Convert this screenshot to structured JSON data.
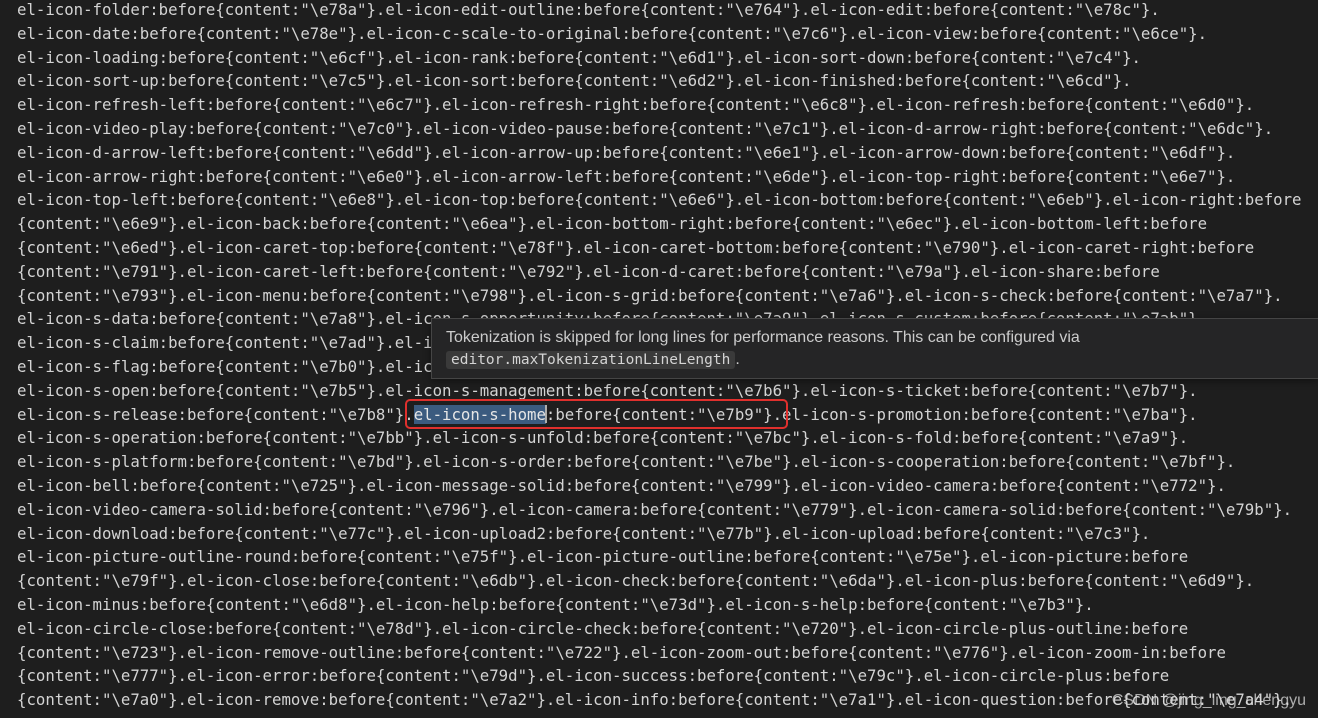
{
  "lines": [
    "el-icon-folder:before{content:\"\\e78a\"}.el-icon-edit-outline:before{content:\"\\e764\"}.el-icon-edit:before{content:\"\\e78c\"}.",
    "el-icon-date:before{content:\"\\e78e\"}.el-icon-c-scale-to-original:before{content:\"\\e7c6\"}.el-icon-view:before{content:\"\\e6ce\"}.",
    "el-icon-loading:before{content:\"\\e6cf\"}.el-icon-rank:before{content:\"\\e6d1\"}.el-icon-sort-down:before{content:\"\\e7c4\"}.",
    "el-icon-sort-up:before{content:\"\\e7c5\"}.el-icon-sort:before{content:\"\\e6d2\"}.el-icon-finished:before{content:\"\\e6cd\"}.",
    "el-icon-refresh-left:before{content:\"\\e6c7\"}.el-icon-refresh-right:before{content:\"\\e6c8\"}.el-icon-refresh:before{content:\"\\e6d0\"}.",
    "el-icon-video-play:before{content:\"\\e7c0\"}.el-icon-video-pause:before{content:\"\\e7c1\"}.el-icon-d-arrow-right:before{content:\"\\e6dc\"}.",
    "el-icon-d-arrow-left:before{content:\"\\e6dd\"}.el-icon-arrow-up:before{content:\"\\e6e1\"}.el-icon-arrow-down:before{content:\"\\e6df\"}.",
    "el-icon-arrow-right:before{content:\"\\e6e0\"}.el-icon-arrow-left:before{content:\"\\e6de\"}.el-icon-top-right:before{content:\"\\e6e7\"}.",
    "el-icon-top-left:before{content:\"\\e6e8\"}.el-icon-top:before{content:\"\\e6e6\"}.el-icon-bottom:before{content:\"\\e6eb\"}.el-icon-right:before",
    "{content:\"\\e6e9\"}.el-icon-back:before{content:\"\\e6ea\"}.el-icon-bottom-right:before{content:\"\\e6ec\"}.el-icon-bottom-left:before",
    "{content:\"\\e6ed\"}.el-icon-caret-top:before{content:\"\\e78f\"}.el-icon-caret-bottom:before{content:\"\\e790\"}.el-icon-caret-right:before",
    "{content:\"\\e791\"}.el-icon-caret-left:before{content:\"\\e792\"}.el-icon-d-caret:before{content:\"\\e79a\"}.el-icon-share:before",
    "{content:\"\\e793\"}.el-icon-menu:before{content:\"\\e798\"}.el-icon-s-grid:before{content:\"\\e7a6\"}.el-icon-s-check:before{content:\"\\e7a7\"}.",
    "el-icon-s-data:before{content:\"\\e7a8\"}.el-icon-s-opportunity:before{content:\"\\e7a9\"}.el-icon-s-custom:before{content:\"\\e7ab\"}.",
    "el-icon-s-claim:before{content:\"\\e7ad\"}.el-icon-s-finance:before{content:\"\\e7ae\"}.el-icon-s-comment:before{content:\"\\e7af\"}.",
    "el-icon-s-flag:before{content:\"\\e7b0\"}.el-icon-s-marketing:before{content:\"\\e7b1\"}.el-icon-s-shop:before{content:\"\\e7b2\"}.",
    "el-icon-s-open:before{content:\"\\e7b5\"}.el-icon-s-management:before{content:\"\\e7b6\"}.el-icon-s-ticket:before{content:\"\\e7b7\"}.",
    null,
    "el-icon-s-operation:before{content:\"\\e7bb\"}.el-icon-s-unfold:before{content:\"\\e7bc\"}.el-icon-s-fold:before{content:\"\\e7a9\"}.",
    "el-icon-s-platform:before{content:\"\\e7bd\"}.el-icon-s-order:before{content:\"\\e7be\"}.el-icon-s-cooperation:before{content:\"\\e7bf\"}.",
    "el-icon-bell:before{content:\"\\e725\"}.el-icon-message-solid:before{content:\"\\e799\"}.el-icon-video-camera:before{content:\"\\e772\"}.",
    "el-icon-video-camera-solid:before{content:\"\\e796\"}.el-icon-camera:before{content:\"\\e779\"}.el-icon-camera-solid:before{content:\"\\e79b\"}.",
    "el-icon-download:before{content:\"\\e77c\"}.el-icon-upload2:before{content:\"\\e77b\"}.el-icon-upload:before{content:\"\\e7c3\"}.",
    "el-icon-picture-outline-round:before{content:\"\\e75f\"}.el-icon-picture-outline:before{content:\"\\e75e\"}.el-icon-picture:before",
    "{content:\"\\e79f\"}.el-icon-close:before{content:\"\\e6db\"}.el-icon-check:before{content:\"\\e6da\"}.el-icon-plus:before{content:\"\\e6d9\"}.",
    "el-icon-minus:before{content:\"\\e6d8\"}.el-icon-help:before{content:\"\\e73d\"}.el-icon-s-help:before{content:\"\\e7b3\"}.",
    "el-icon-circle-close:before{content:\"\\e78d\"}.el-icon-circle-check:before{content:\"\\e720\"}.el-icon-circle-plus-outline:before",
    "{content:\"\\e723\"}.el-icon-remove-outline:before{content:\"\\e722\"}.el-icon-zoom-out:before{content:\"\\e776\"}.el-icon-zoom-in:before",
    "{content:\"\\e777\"}.el-icon-error:before{content:\"\\e79d\"}.el-icon-success:before{content:\"\\e79c\"}.el-icon-circle-plus:before",
    "{content:\"\\e7a0\"}.el-icon-remove:before{content:\"\\e7a2\"}.el-icon-info:before{content:\"\\e7a1\"}.el-icon-question:before{content:\"\\e7a4\"}."
  ],
  "selected_line": {
    "before": "el-icon-s-release:before{content:\"\\e7b8\"}.",
    "selected": "el-icon-s-home",
    "after": ":before{content:\"\\e7b9\"}.el-icon-s-promotion:before{content:\"\\e7ba\"}."
  },
  "hover": {
    "message": "Tokenization is skipped for long lines for performance reasons. This can be configured via",
    "setting": "editor.maxTokenizationLineLength",
    "suffix": "."
  },
  "watermark": "CSDN @jing_ling_chengyu",
  "colors": {
    "background": "#1e1e1e",
    "text": "#d4d4d4",
    "selection": "#3b5b7f",
    "annotation_box": "#e0302d",
    "hover_background": "#252526"
  }
}
